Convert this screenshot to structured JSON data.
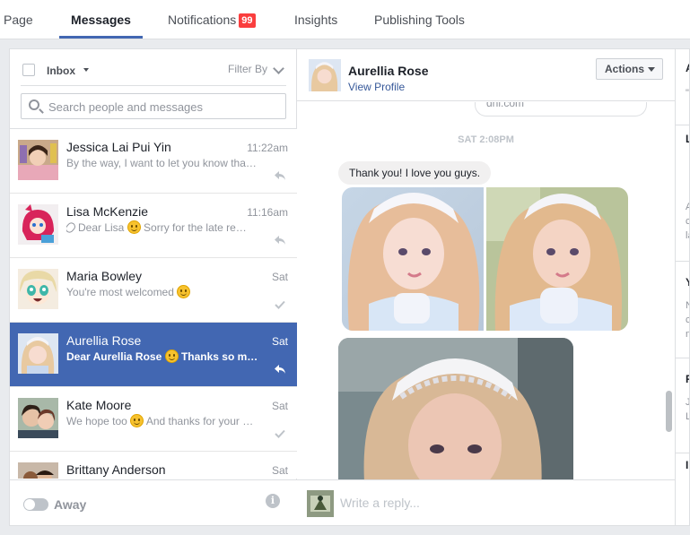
{
  "tabs": [
    {
      "label": "Page"
    },
    {
      "label": "Messages"
    },
    {
      "label": "Notifications",
      "badge": "99"
    },
    {
      "label": "Insights"
    },
    {
      "label": "Publishing Tools"
    }
  ],
  "inbox": {
    "label": "Inbox",
    "filter_label": "Filter By",
    "search_placeholder": "Search people and messages"
  },
  "threads": [
    {
      "name": "Jessica Lai Pui Yin",
      "time": "11:22am",
      "snippet": "By the way, I want to let you know that…",
      "status": "replied"
    },
    {
      "name": "Lisa McKenzie",
      "time": "11:16am",
      "snippet_pre": "Dear Lisa",
      "snippet_post": "Sorry for the late re…",
      "status": "replied"
    },
    {
      "name": "Maria Bowley",
      "time": "Sat",
      "snippet_pre": "You're most welcomed",
      "snippet_post": "",
      "status": "seen"
    },
    {
      "name": "Aurellia Rose",
      "time": "Sat",
      "snippet_pre": "Dear Aurellia Rose",
      "snippet_post": "Thanks so m…",
      "status": "replied"
    },
    {
      "name": "Kate Moore",
      "time": "Sat",
      "snippet_pre": "We hope too",
      "snippet_post": "And thanks for your …",
      "status": "seen"
    },
    {
      "name": "Brittany Anderson",
      "time": "Sat"
    }
  ],
  "away": {
    "label": "Away"
  },
  "conversation": {
    "name": "Aurellia Rose",
    "view_profile": "View Profile",
    "actions_label": "Actions",
    "previous_text": "dhl.com",
    "timestamp": "SAT 2:08PM",
    "message": "Thank you! I love you guys.",
    "reply_placeholder": "Write a reply..."
  },
  "right_panel": [
    {
      "heading": "A",
      "lines": [
        "\""
      ]
    },
    {
      "heading": "L",
      "lines": []
    },
    {
      "heading": "",
      "lines": [
        "A",
        "c",
        "la"
      ]
    },
    {
      "heading": "Y",
      "lines": [
        "N",
        "c",
        "m"
      ]
    },
    {
      "heading": "R",
      "lines": [
        "J",
        "L"
      ]
    },
    {
      "heading": "In",
      "lines": []
    }
  ],
  "colors": {
    "accent": "#4267b2",
    "badge": "#fa3e3e"
  }
}
